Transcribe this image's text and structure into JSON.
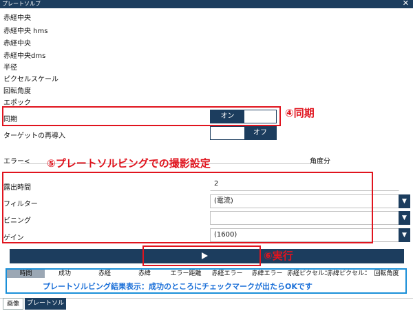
{
  "window": {
    "title": "プレートソルブ",
    "close": "✕"
  },
  "info_rows": [
    "赤経中央",
    "赤経中央 hms",
    "赤経中央",
    "赤経中央dms",
    "半径",
    "ピクセルスケール",
    "回転角度",
    "エポック"
  ],
  "sync": {
    "label": "同期",
    "on": "オン"
  },
  "reslew": {
    "label": "ターゲットの再導入",
    "off": "オフ"
  },
  "error": {
    "label": "エラー<",
    "unit": "角度分"
  },
  "exposure": {
    "time_label": "露出時間",
    "time_value": "2",
    "filter_label": "フィルター",
    "filter_value": "(電流)",
    "binning_label": "ビニング",
    "binning_value": "",
    "gain_label": "ゲイン",
    "gain_value": "(1600)"
  },
  "results_headers": [
    "時間",
    "成功",
    "赤経",
    "赤緯",
    "エラー距離",
    "赤経エラー",
    "赤緯エラー",
    "赤経ピクセルエ",
    "赤緯ピクセルエ",
    "回転角度"
  ],
  "annotations": {
    "sync": "④同期",
    "settings": "⑤プレートソルビングでの撮影設定",
    "run": "⑥実行",
    "results": "プレートソルビング結果表示：成功のところにチェックマークが出たらOKです"
  },
  "tabs": [
    "画像",
    "プレートソルブ"
  ],
  "colors": {
    "navy": "#1c3d5e",
    "annotation_red": "#e0141e",
    "annotation_blue": "#1a8fd8"
  }
}
